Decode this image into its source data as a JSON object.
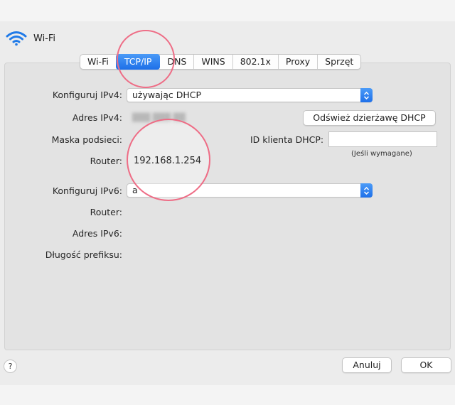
{
  "header": {
    "title": "Wi-Fi",
    "icon": "wifi-icon"
  },
  "tabs": [
    {
      "label": "Wi-Fi",
      "active": false
    },
    {
      "label": "TCP/IP",
      "active": true
    },
    {
      "label": "DNS",
      "active": false
    },
    {
      "label": "WINS",
      "active": false
    },
    {
      "label": "802.1x",
      "active": false
    },
    {
      "label": "Proxy",
      "active": false
    },
    {
      "label": "Sprzęt",
      "active": false
    }
  ],
  "ipv4": {
    "configure_label": "Konfiguruj IPv4:",
    "configure_value": "używając DHCP",
    "address_label": "Adres IPv4:",
    "mask_label": "Maska podsieci:",
    "router_label": "Router:",
    "router_value": "192.168.1.254",
    "renew_button": "Odśwież dzierżawę DHCP",
    "client_id_label": "ID klienta DHCP:",
    "client_id_value": "",
    "client_id_hint": "(Jeśli wymagane)"
  },
  "ipv6": {
    "configure_label": "Konfiguruj IPv6:",
    "configure_value": "a",
    "router_label": "Router:",
    "address_label": "Adres IPv6:",
    "prefix_label": "Długość prefiksu:"
  },
  "footer": {
    "help": "?",
    "cancel": "Anuluj",
    "ok": "OK"
  },
  "colors": {
    "accent": "#1d6fe8",
    "highlight_circle": "#ee6d86"
  }
}
